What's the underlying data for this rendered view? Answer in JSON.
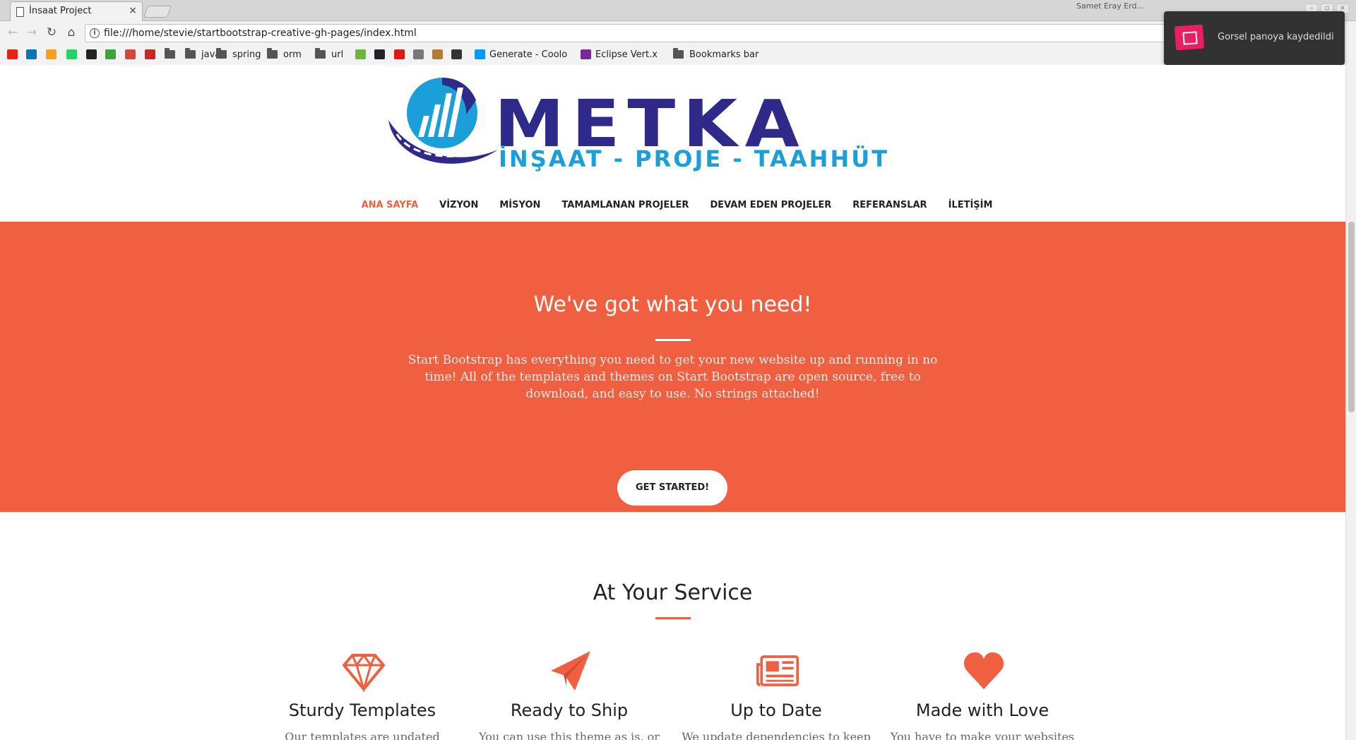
{
  "browser": {
    "tab_title": "İnsaat Project",
    "tab_close": "×",
    "profile": "Samet Eray Erd...",
    "url": "file:///home/stevie/startbootstrap-creative-gh-pages/index.html",
    "bookmarks": [
      {
        "label": "",
        "icon": "youtube-icon",
        "color": "#e62117"
      },
      {
        "label": "",
        "icon": "linkedin-icon",
        "color": "#0077b5"
      },
      {
        "label": "",
        "icon": "arrow-bookmark-icon",
        "color": "#f4a020"
      },
      {
        "label": "",
        "icon": "whatsapp-icon",
        "color": "#25d366"
      },
      {
        "label": "",
        "icon": "github-icon",
        "color": "#222222"
      },
      {
        "label": "",
        "icon": "green-bookmark-icon",
        "color": "#3aa33a"
      },
      {
        "label": "",
        "icon": "gmail-icon",
        "color": "#d44638"
      },
      {
        "label": "",
        "icon": "red-cube-icon",
        "color": "#c62828"
      },
      {
        "label": "",
        "icon": "folder-icon",
        "color": "#555555"
      },
      {
        "label": "java",
        "icon": "folder-icon",
        "color": "#555555"
      },
      {
        "label": "spring",
        "icon": "folder-icon",
        "color": "#555555"
      },
      {
        "label": "orm",
        "icon": "folder-icon",
        "color": "#555555"
      },
      {
        "label": "url",
        "icon": "folder-icon",
        "color": "#555555"
      },
      {
        "label": "",
        "icon": "leaf-icon",
        "color": "#6db33f"
      },
      {
        "label": "",
        "icon": "react-icon",
        "color": "#20232a"
      },
      {
        "label": "",
        "icon": "angular-icon",
        "color": "#dd1b16"
      },
      {
        "label": "",
        "icon": "link-icon",
        "color": "#777777"
      },
      {
        "label": "",
        "icon": "avatar-bookmark-icon",
        "color": "#b07a3a"
      },
      {
        "label": "",
        "icon": "puppet-icon",
        "color": "#333333"
      },
      {
        "label": "Generate - Coolo",
        "icon": "coolors-icon",
        "color": "#0099ff"
      },
      {
        "label": "Eclipse Vert.x",
        "icon": "vertx-icon",
        "color": "#782a90"
      },
      {
        "label": "Bookmarks bar",
        "icon": "folder-icon",
        "color": "#555555"
      }
    ]
  },
  "toast": {
    "text": "Gorsel panoya kaydedildi",
    "accent": "#e91e63"
  },
  "logo": {
    "wordmark": "METKA",
    "tagline": "İNŞAAT - PROJE - TAAHHÜT",
    "colors": {
      "primary": "#2f2a8a",
      "secondary": "#1a9fd8"
    }
  },
  "nav": {
    "items": [
      {
        "label": "ANA SAYFA",
        "active": true
      },
      {
        "label": "VİZYON",
        "active": false
      },
      {
        "label": "MİSYON",
        "active": false
      },
      {
        "label": "TAMAMLANAN PROJELER",
        "active": false
      },
      {
        "label": "DEVAM EDEN PROJELER",
        "active": false
      },
      {
        "label": "REFERANSLAR",
        "active": false
      },
      {
        "label": "İLETİŞİM",
        "active": false
      }
    ]
  },
  "hero": {
    "title": "We've got what you need!",
    "text": "Start Bootstrap has everything you need to get your new website up and running in no time! All of the templates and themes on Start Bootstrap are open source, free to download, and easy to use. No strings attached!",
    "button": "GET STARTED!",
    "background": "#f05f40"
  },
  "services": {
    "title": "At Your Service",
    "items": [
      {
        "title": "Sturdy Templates",
        "desc": "Our templates are updated",
        "icon": "diamond-icon"
      },
      {
        "title": "Ready to Ship",
        "desc": "You can use this theme as is, or",
        "icon": "paper-plane-icon"
      },
      {
        "title": "Up to Date",
        "desc": "We update dependencies to keep",
        "icon": "newspaper-icon"
      },
      {
        "title": "Made with Love",
        "desc": "You have to make your websites",
        "icon": "heart-icon"
      }
    ]
  }
}
